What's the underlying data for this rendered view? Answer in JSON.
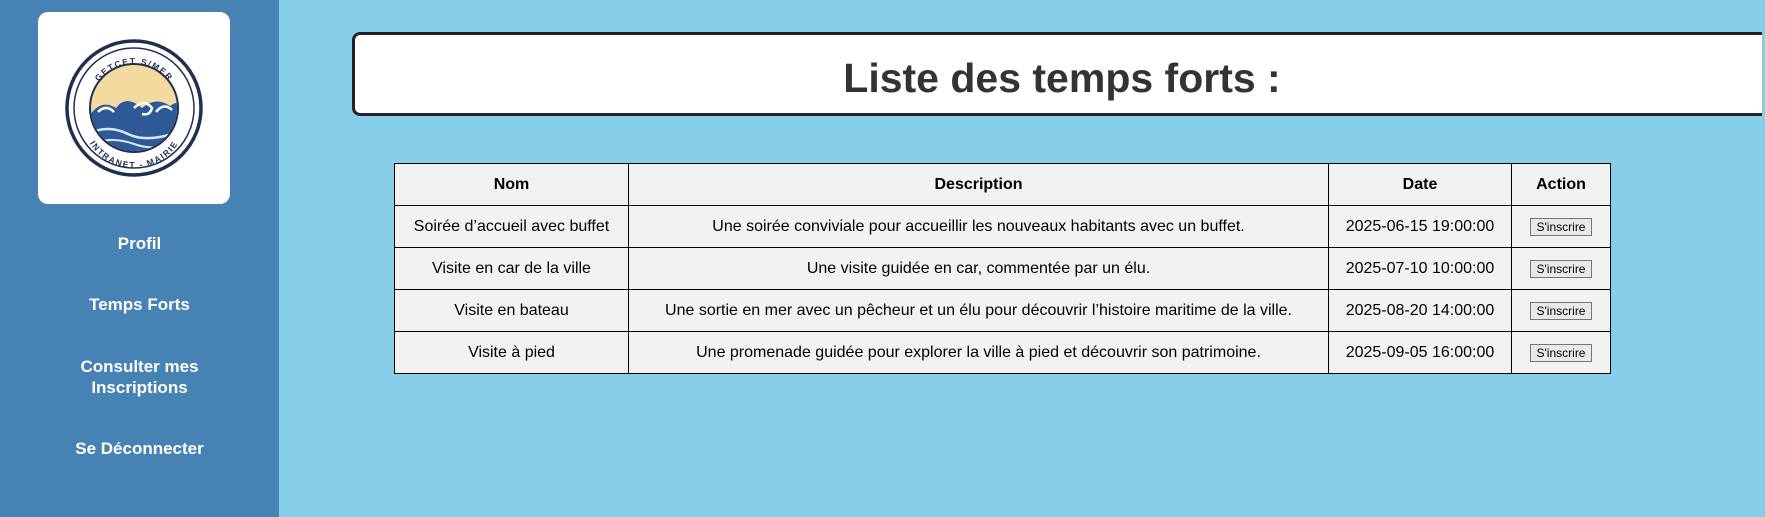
{
  "sidebar": {
    "logo": {
      "top_text": "GETCET S/MER",
      "bottom_text": "INTRANET - MAIRIE",
      "colors": {
        "ring": "#1f2f4f",
        "sun": "#f3dba0",
        "wave": "#2d5a96"
      }
    },
    "nav": [
      {
        "label": "Profil"
      },
      {
        "label": "Temps Forts"
      },
      {
        "label": "Consulter mes Inscriptions"
      },
      {
        "label": "Se Déconnecter"
      }
    ]
  },
  "main": {
    "title": "Liste des temps forts :",
    "table": {
      "headers": [
        "Nom",
        "Description",
        "Date",
        "Action"
      ],
      "rows": [
        {
          "nom": "Soirée d’accueil avec buffet",
          "description": "Une soirée conviviale pour accueillir les nouveaux habitants avec un buffet.",
          "date": "2025-06-15 19:00:00",
          "action": "S'inscrire"
        },
        {
          "nom": "Visite en car de la ville",
          "description": "Une visite guidée en car, commentée par un élu.",
          "date": "2025-07-10 10:00:00",
          "action": "S'inscrire"
        },
        {
          "nom": "Visite en bateau",
          "description": "Une sortie en mer avec un pêcheur et un élu pour découvrir l’histoire maritime de la ville.",
          "date": "2025-08-20 14:00:00",
          "action": "S'inscrire"
        },
        {
          "nom": "Visite à pied",
          "description": "Une promenade guidée pour explorer la ville à pied et découvrir son patrimoine.",
          "date": "2025-09-05 16:00:00",
          "action": "S'inscrire"
        }
      ]
    }
  },
  "colors": {
    "background": "#87ceeb",
    "sidebar": "#4682b4",
    "table_bg": "#f2f2f2"
  }
}
